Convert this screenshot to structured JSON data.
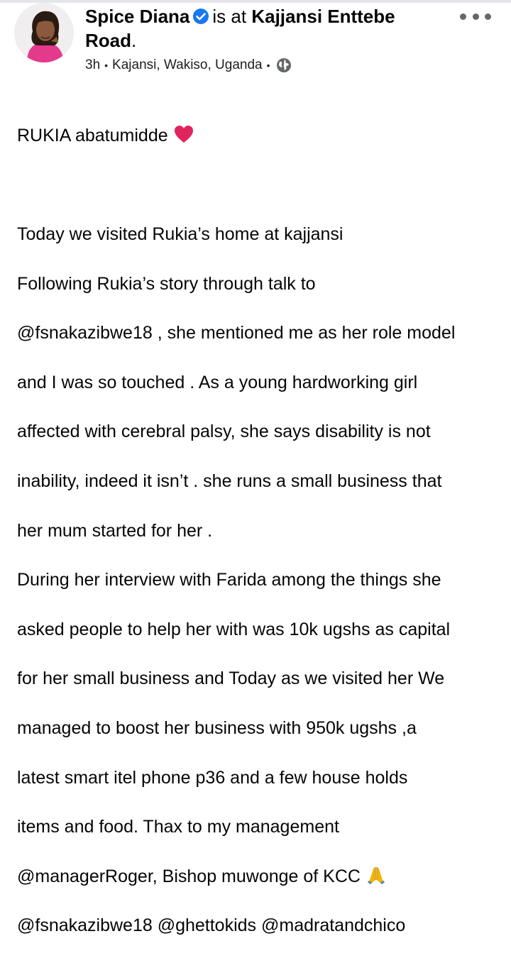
{
  "post": {
    "author": "Spice Diana",
    "is_at": "is at",
    "location_name_line1": "Kajjansi Enttebe",
    "location_name_line2": "Road",
    "location_punct": ".",
    "timestamp": "3h",
    "place": "Kajansi, Wakiso, Uganda",
    "privacy_icon": "globe-icon",
    "verified_icon": "verified-badge-icon",
    "more_icon": "more-options-icon",
    "colors": {
      "verified": "#1877f2",
      "meta_text": "#1c1e21",
      "icon_gray": "#65676b",
      "heart": "#e0245e",
      "pray": "#f5b400"
    },
    "body": {
      "line1": "RUKIA abatumidde",
      "lines": [
        "Today we visited Rukia’s home at kajjansi",
        "Following Rukia’s story through talk to",
        "@fsnakazibwe18 , she mentioned me as her role model",
        "and I was so touched . As a young hardworking girl",
        "affected with cerebral palsy, she says disability is not",
        "inability, indeed it isn’t . she runs a small business that",
        "her mum started for her .",
        "During her interview with Farida  among the things she",
        "asked people to help her with was 10k ugshs as capital",
        "for her small business and Today as we visited her We",
        "managed to boost her business with 950k ugshs ,a",
        "latest smart  itel phone p36 and a few house holds",
        "items and food. Thax to my management",
        "@managerRoger, Bishop muwonge of KCC",
        "@fsnakazibwe18 @ghettokids @madratandchico"
      ]
    }
  }
}
